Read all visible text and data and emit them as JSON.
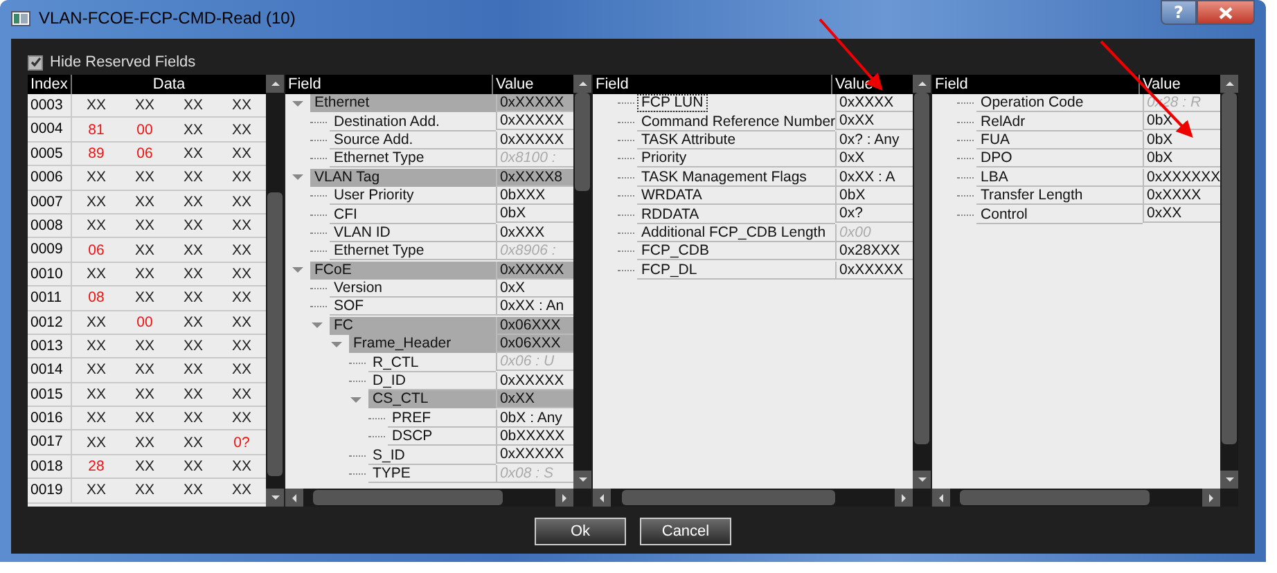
{
  "window": {
    "title": "VLAN-FCOE-FCP-CMD-Read (10)",
    "help": "?"
  },
  "hide_reserved": {
    "label": "Hide Reserved Fields",
    "checked": true
  },
  "hex_table": {
    "columns": [
      "Index",
      "Data"
    ],
    "rows": [
      {
        "index": "0003",
        "cells": [
          {
            "text": "XX",
            "highlighted": false
          },
          {
            "text": "XX",
            "highlighted": false
          },
          {
            "text": "XX",
            "highlighted": false
          },
          {
            "text": "XX",
            "highlighted": false
          }
        ]
      },
      {
        "index": "0004",
        "cells": [
          {
            "text": "81",
            "highlighted": true
          },
          {
            "text": "00",
            "highlighted": true
          },
          {
            "text": "XX",
            "highlighted": false
          },
          {
            "text": "XX",
            "highlighted": false
          }
        ]
      },
      {
        "index": "0005",
        "cells": [
          {
            "text": "89",
            "highlighted": true
          },
          {
            "text": "06",
            "highlighted": true
          },
          {
            "text": "XX",
            "highlighted": false
          },
          {
            "text": "XX",
            "highlighted": false
          }
        ]
      },
      {
        "index": "0006",
        "cells": [
          {
            "text": "XX",
            "highlighted": false
          },
          {
            "text": "XX",
            "highlighted": false
          },
          {
            "text": "XX",
            "highlighted": false
          },
          {
            "text": "XX",
            "highlighted": false
          }
        ]
      },
      {
        "index": "0007",
        "cells": [
          {
            "text": "XX",
            "highlighted": false
          },
          {
            "text": "XX",
            "highlighted": false
          },
          {
            "text": "XX",
            "highlighted": false
          },
          {
            "text": "XX",
            "highlighted": false
          }
        ]
      },
      {
        "index": "0008",
        "cells": [
          {
            "text": "XX",
            "highlighted": false
          },
          {
            "text": "XX",
            "highlighted": false
          },
          {
            "text": "XX",
            "highlighted": false
          },
          {
            "text": "XX",
            "highlighted": false
          }
        ]
      },
      {
        "index": "0009",
        "cells": [
          {
            "text": "06",
            "highlighted": true
          },
          {
            "text": "XX",
            "highlighted": false
          },
          {
            "text": "XX",
            "highlighted": false
          },
          {
            "text": "XX",
            "highlighted": false
          }
        ]
      },
      {
        "index": "0010",
        "cells": [
          {
            "text": "XX",
            "highlighted": false
          },
          {
            "text": "XX",
            "highlighted": false
          },
          {
            "text": "XX",
            "highlighted": false
          },
          {
            "text": "XX",
            "highlighted": false
          }
        ]
      },
      {
        "index": "0011",
        "cells": [
          {
            "text": "08",
            "highlighted": true
          },
          {
            "text": "XX",
            "highlighted": false
          },
          {
            "text": "XX",
            "highlighted": false
          },
          {
            "text": "XX",
            "highlighted": false
          }
        ]
      },
      {
        "index": "0012",
        "cells": [
          {
            "text": "XX",
            "highlighted": false
          },
          {
            "text": "00",
            "highlighted": true
          },
          {
            "text": "XX",
            "highlighted": false
          },
          {
            "text": "XX",
            "highlighted": false
          }
        ]
      },
      {
        "index": "0013",
        "cells": [
          {
            "text": "XX",
            "highlighted": false
          },
          {
            "text": "XX",
            "highlighted": false
          },
          {
            "text": "XX",
            "highlighted": false
          },
          {
            "text": "XX",
            "highlighted": false
          }
        ]
      },
      {
        "index": "0014",
        "cells": [
          {
            "text": "XX",
            "highlighted": false
          },
          {
            "text": "XX",
            "highlighted": false
          },
          {
            "text": "XX",
            "highlighted": false
          },
          {
            "text": "XX",
            "highlighted": false
          }
        ]
      },
      {
        "index": "0015",
        "cells": [
          {
            "text": "XX",
            "highlighted": false
          },
          {
            "text": "XX",
            "highlighted": false
          },
          {
            "text": "XX",
            "highlighted": false
          },
          {
            "text": "XX",
            "highlighted": false
          }
        ]
      },
      {
        "index": "0016",
        "cells": [
          {
            "text": "XX",
            "highlighted": false
          },
          {
            "text": "XX",
            "highlighted": false
          },
          {
            "text": "XX",
            "highlighted": false
          },
          {
            "text": "XX",
            "highlighted": false
          }
        ]
      },
      {
        "index": "0017",
        "cells": [
          {
            "text": "XX",
            "highlighted": false
          },
          {
            "text": "XX",
            "highlighted": false
          },
          {
            "text": "XX",
            "highlighted": false
          },
          {
            "text": "0?",
            "highlighted": true
          }
        ]
      },
      {
        "index": "0018",
        "cells": [
          {
            "text": "28",
            "highlighted": true
          },
          {
            "text": "XX",
            "highlighted": false
          },
          {
            "text": "XX",
            "highlighted": false
          },
          {
            "text": "XX",
            "highlighted": false
          }
        ]
      },
      {
        "index": "0019",
        "cells": [
          {
            "text": "XX",
            "highlighted": false
          },
          {
            "text": "XX",
            "highlighted": false
          },
          {
            "text": "XX",
            "highlighted": false
          },
          {
            "text": "XX",
            "highlighted": false
          }
        ]
      }
    ]
  },
  "trees": [
    {
      "columns": [
        "Field",
        "Value"
      ],
      "nodes": [
        {
          "field": "Ethernet",
          "value": "0xXXXXX",
          "muted": false,
          "expanded": true,
          "children": [
            {
              "field": "Destination Add.",
              "value": "0xXXXXX",
              "muted": false
            },
            {
              "field": "Source Add.",
              "value": "0xXXXXX",
              "muted": false
            },
            {
              "field": "Ethernet Type",
              "value": "0x8100 :",
              "muted": true
            }
          ]
        },
        {
          "field": "VLAN Tag",
          "value": "0xXXXX8",
          "muted": false,
          "expanded": true,
          "children": [
            {
              "field": "User Priority",
              "value": "0bXXX",
              "muted": false
            },
            {
              "field": "CFI",
              "value": "0bX",
              "muted": false
            },
            {
              "field": "VLAN ID",
              "value": "0xXXX",
              "muted": false
            },
            {
              "field": "Ethernet Type",
              "value": "0x8906 :",
              "muted": true
            }
          ]
        },
        {
          "field": "FCoE",
          "value": "0xXXXXX",
          "muted": false,
          "expanded": true,
          "children": [
            {
              "field": "Version",
              "value": "0xX",
              "muted": false
            },
            {
              "field": "SOF",
              "value": "0xXX : An",
              "muted": false
            },
            {
              "field": "FC",
              "value": "0x06XXX",
              "muted": false,
              "expanded": true,
              "children": [
                {
                  "field": "Frame_Header",
                  "value": "0x06XXX",
                  "muted": false,
                  "expanded": true,
                  "children": [
                    {
                      "field": "R_CTL",
                      "value": "0x06 : U",
                      "muted": true
                    },
                    {
                      "field": "D_ID",
                      "value": "0xXXXXX",
                      "muted": false
                    },
                    {
                      "field": "CS_CTL",
                      "value": "0xXX",
                      "muted": false,
                      "expanded": true,
                      "children": [
                        {
                          "field": "PREF",
                          "value": "0bX : Any",
                          "muted": false
                        },
                        {
                          "field": "DSCP",
                          "value": "0bXXXXX",
                          "muted": false
                        }
                      ]
                    },
                    {
                      "field": "S_ID",
                      "value": "0xXXXXX",
                      "muted": false
                    },
                    {
                      "field": "TYPE",
                      "value": "0x08 : S",
                      "muted": true
                    }
                  ]
                }
              ]
            }
          ]
        }
      ]
    },
    {
      "columns": [
        "Field",
        "Value"
      ],
      "nodes": [
        {
          "field": "FCP LUN",
          "value": "0xXXXX",
          "muted": false,
          "focused": true
        },
        {
          "field": "Command Reference Number",
          "value": "0xXX",
          "muted": false,
          "focused": false
        },
        {
          "field": "TASK Attribute",
          "value": "0x? : Any",
          "muted": false,
          "focused": false
        },
        {
          "field": "Priority",
          "value": "0xX",
          "muted": false,
          "focused": false
        },
        {
          "field": "TASK Management Flags",
          "value": "0xXX : A",
          "muted": false,
          "focused": false
        },
        {
          "field": "WRDATA",
          "value": "0bX",
          "muted": false,
          "focused": false
        },
        {
          "field": "RDDATA",
          "value": "0x?",
          "muted": false,
          "focused": false
        },
        {
          "field": "Additional FCP_CDB Length",
          "value": "0x00",
          "muted": true,
          "focused": false
        },
        {
          "field": "FCP_CDB",
          "value": "0x28XXX",
          "muted": false,
          "focused": false
        },
        {
          "field": "FCP_DL",
          "value": "0xXXXXX",
          "muted": false,
          "focused": false
        }
      ]
    },
    {
      "columns": [
        "Field",
        "Value"
      ],
      "nodes": [
        {
          "field": "Operation Code",
          "value": "0x28 : R",
          "muted": true
        },
        {
          "field": "RelAdr",
          "value": "0bX",
          "muted": false
        },
        {
          "field": "FUA",
          "value": "0bX",
          "muted": false
        },
        {
          "field": "DPO",
          "value": "0bX",
          "muted": false
        },
        {
          "field": "LBA",
          "value": "0xXXXXXX",
          "muted": false
        },
        {
          "field": "Transfer Length",
          "value": "0xXXXX",
          "muted": false
        },
        {
          "field": "Control",
          "value": "0xXX",
          "muted": false
        }
      ]
    }
  ],
  "buttons": [
    "Ok",
    "Cancel"
  ]
}
